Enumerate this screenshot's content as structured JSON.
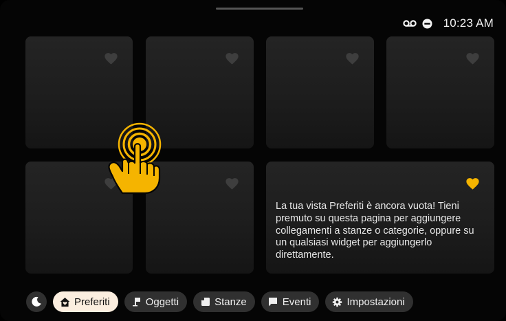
{
  "status_bar": {
    "time": "10:23 AM",
    "icons": [
      "voicemail-icon",
      "do-not-disturb-icon"
    ]
  },
  "colors": {
    "favorite_active": "#f5b400",
    "favorite_inactive": "#3e3e3e",
    "active_tab_bg": "#fbeedf",
    "pill_bg": "#303030"
  },
  "favorites_grid": {
    "empty_message": "La tua vista Preferiti è ancora vuota! Tieni premuto su questa pagina per aggiungere collegamenti a stanze o categorie, oppure su un qualsiasi widget per aggiungerlo direttamente."
  },
  "gesture_hint": {
    "icon": "tap-and-hold-hand-icon"
  },
  "bottom_nav": {
    "night_mode_icon": "moon-icon",
    "items": [
      {
        "label": "Preferiti",
        "icon": "home-heart-icon",
        "active": true
      },
      {
        "label": "Oggetti",
        "icon": "lamp-icon",
        "active": false
      },
      {
        "label": "Stanze",
        "icon": "room-icon",
        "active": false
      },
      {
        "label": "Eventi",
        "icon": "chat-icon",
        "active": false
      },
      {
        "label": "Impostazioni",
        "icon": "gear-icon",
        "active": false
      }
    ]
  }
}
